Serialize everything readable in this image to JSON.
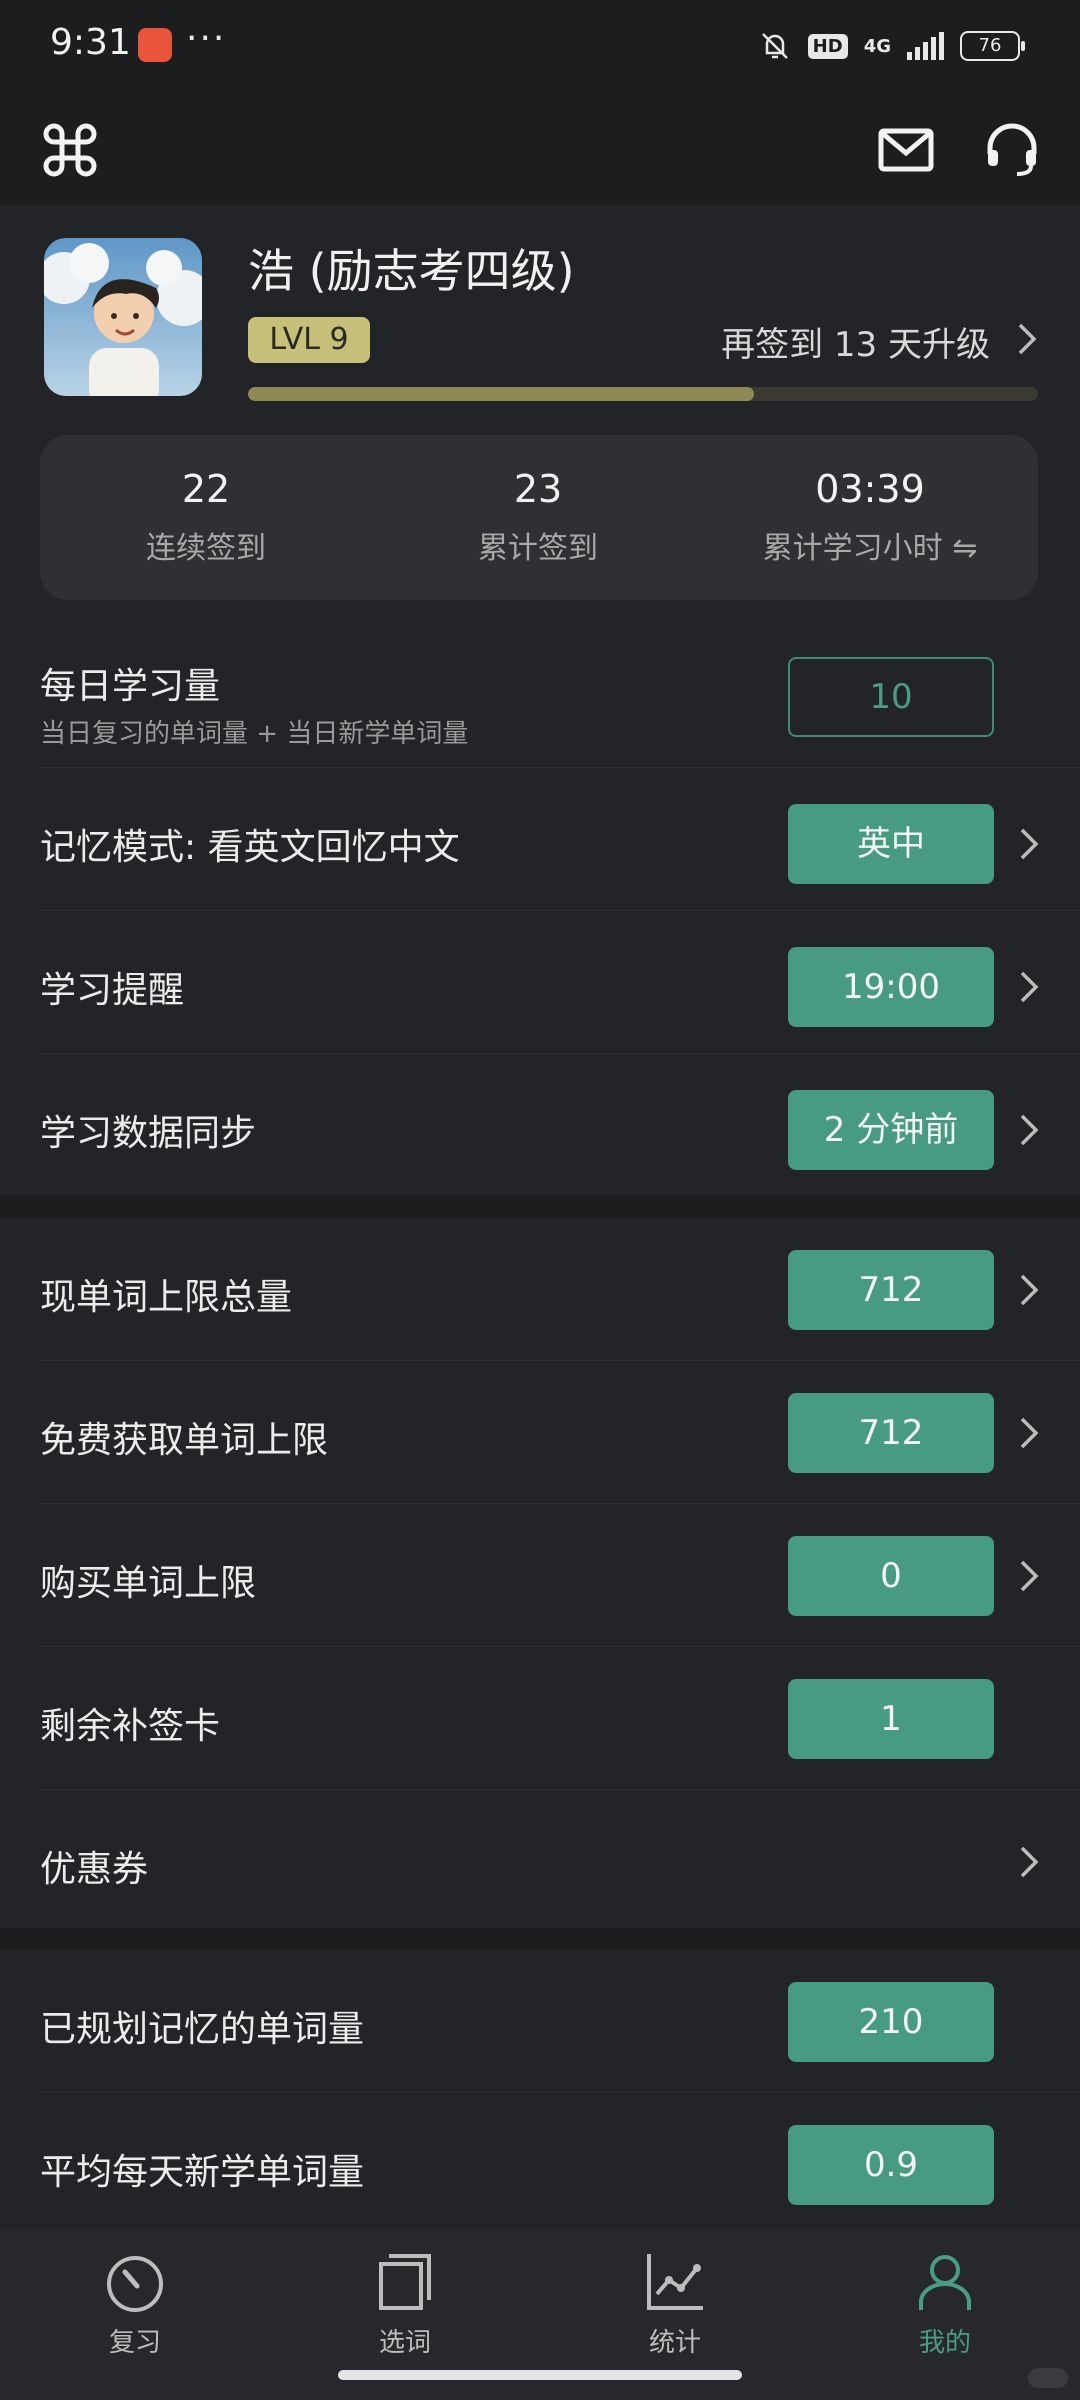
{
  "status_bar": {
    "time": "9:31",
    "dots": "···",
    "hd": "HD",
    "network": "4G",
    "battery": "76"
  },
  "profile": {
    "name": "浩 (励志考四级)",
    "level": "LVL 9",
    "upgrade_text": "再签到 13 天升级",
    "level_progress": 0.64
  },
  "stats": [
    {
      "value": "22",
      "label": "连续签到"
    },
    {
      "value": "23",
      "label": "累计签到"
    },
    {
      "value": "03:39",
      "label": "累计学习小时 ⇋"
    }
  ],
  "settings": {
    "daily": {
      "label": "每日学习量",
      "sub": "当日复习的单词量 + 当日新学单词量",
      "value": "10"
    },
    "memory_mode": {
      "label": "记忆模式: 看英文回忆中文",
      "value": "英中"
    },
    "reminder": {
      "label": "学习提醒",
      "value": "19:00"
    },
    "sync": {
      "label": "学习数据同步",
      "value": "2 分钟前"
    }
  },
  "words": {
    "current_limit": {
      "label": "现单词上限总量",
      "value": "712"
    },
    "free_limit": {
      "label": "免费获取单词上限",
      "value": "712"
    },
    "purchased_limit": {
      "label": "购买单词上限",
      "value": "0"
    },
    "makeup_cards": {
      "label": "剩余补签卡",
      "value": "1"
    },
    "coupons": {
      "label": "优惠券"
    }
  },
  "plan": {
    "planned": {
      "label": "已规划记忆的单词量",
      "value": "210"
    },
    "avg_new": {
      "label": "平均每天新学单词量",
      "value": "0.9"
    }
  },
  "nav": [
    {
      "label": "复习",
      "icon": "review-dial-icon"
    },
    {
      "label": "选词",
      "icon": "select-words-icon"
    },
    {
      "label": "统计",
      "icon": "stats-chart-icon"
    },
    {
      "label": "我的",
      "icon": "profile-person-icon",
      "active": true
    }
  ],
  "colors": {
    "accent": "#469b82",
    "background": "#1b1c1e",
    "card": "#232427",
    "level_badge": "#c6c07a"
  }
}
